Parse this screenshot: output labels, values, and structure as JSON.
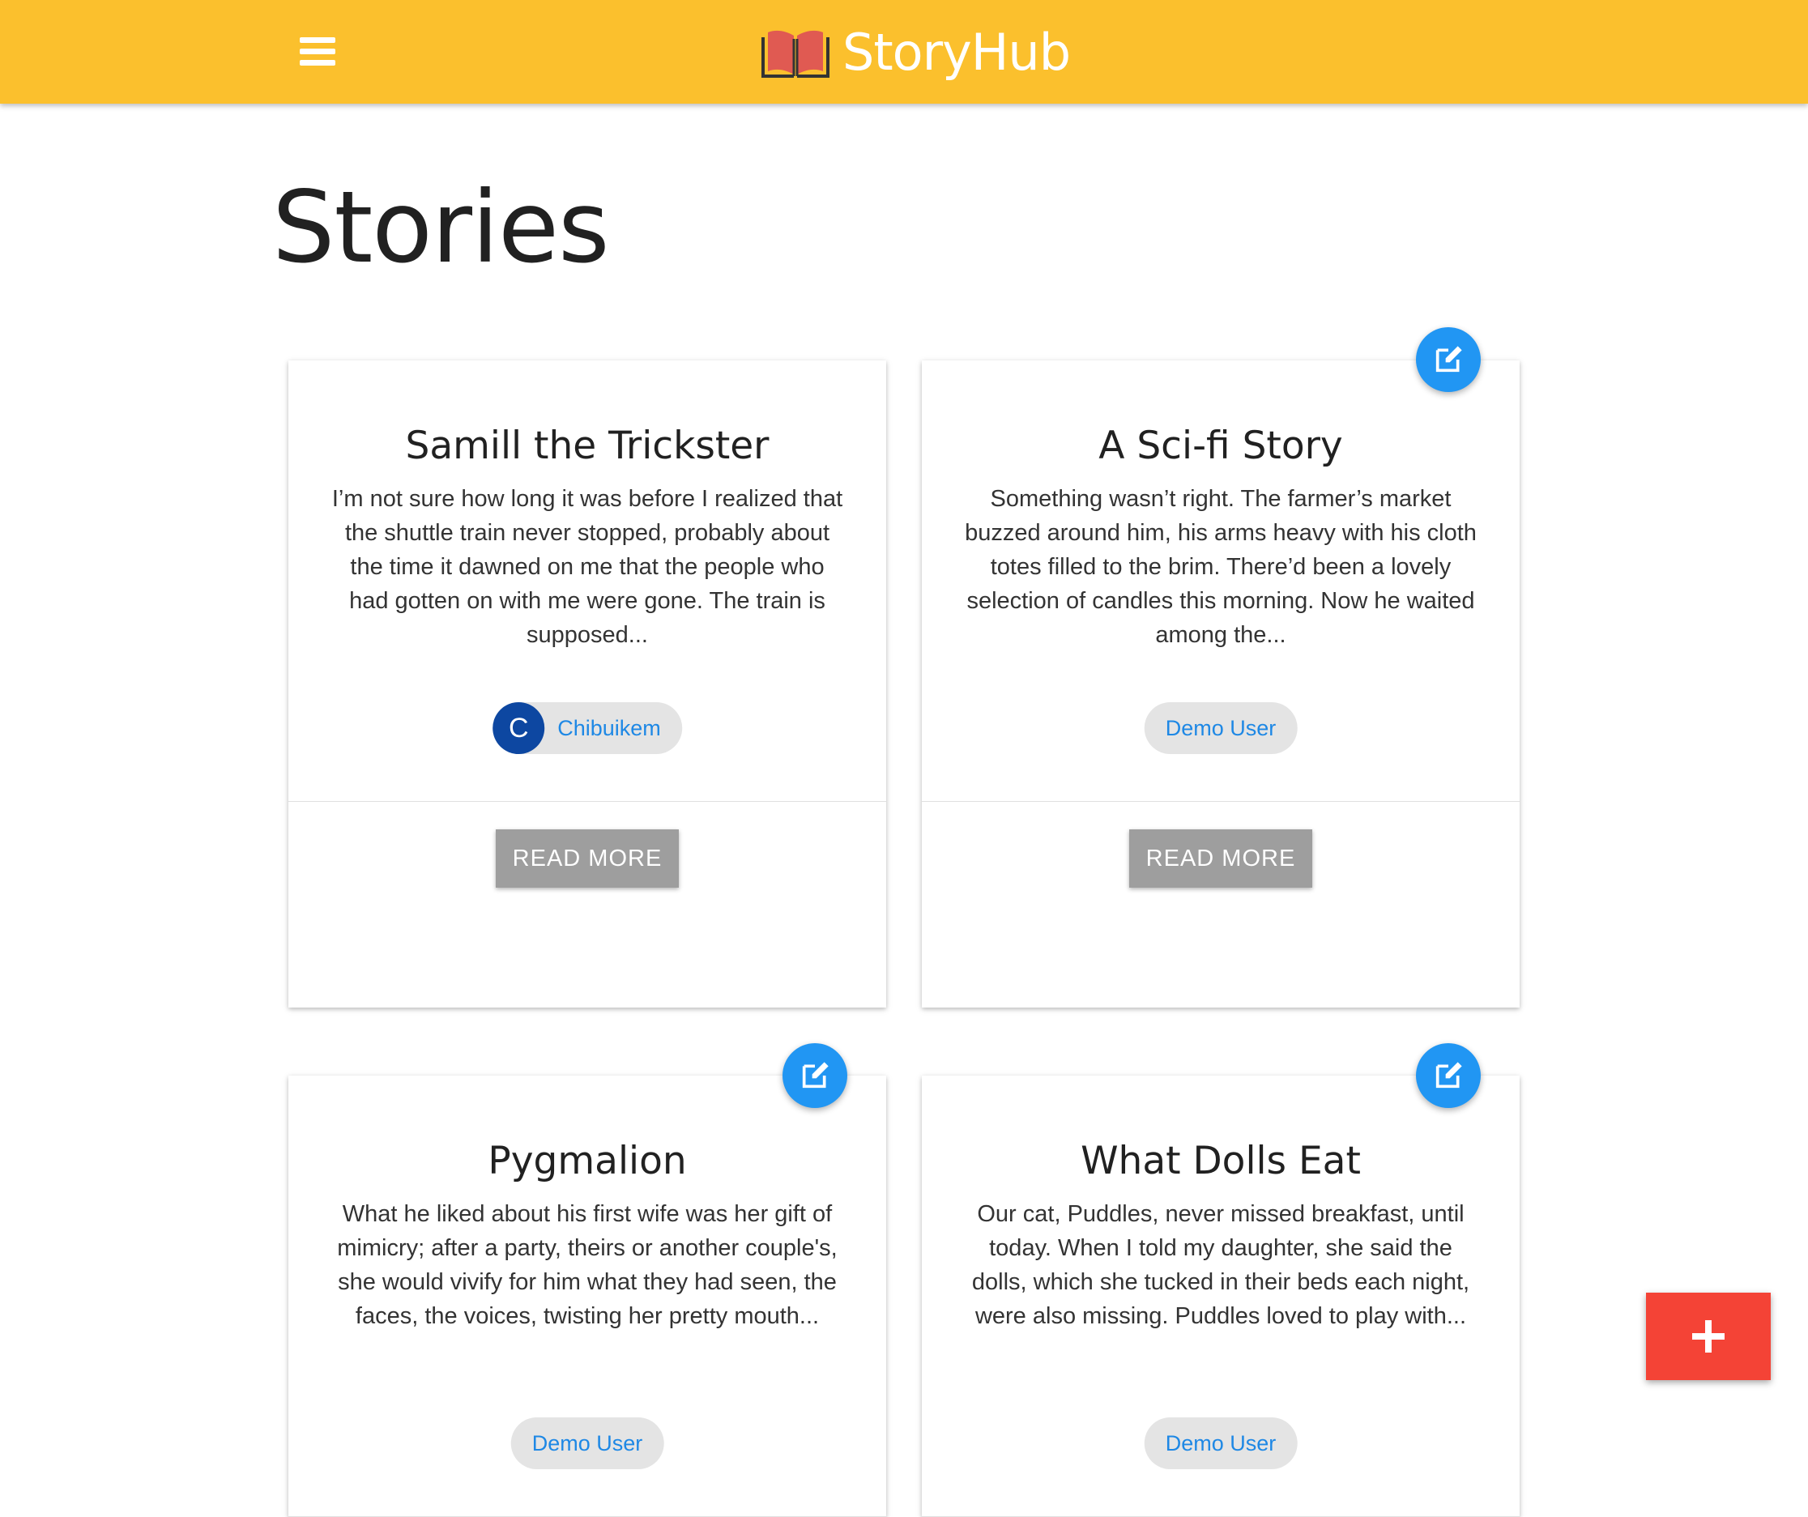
{
  "header": {
    "brand": "StoryHub",
    "menu_icon": "hamburger-menu-icon",
    "brand_icon": "open-book-icon",
    "background": "#fbc02d"
  },
  "page": {
    "title": "Stories"
  },
  "stories": [
    {
      "title": "Samill the Trickster",
      "excerpt": "I’m not sure how long it was before I realized that the shuttle train never stopped, probably about the time it dawned on me that the people who had gotten on with me were gone. The train is supposed...",
      "author": "Chibuikem",
      "author_initial": "C",
      "action": "READ MORE",
      "editable": false
    },
    {
      "title": "A Sci-fi Story",
      "excerpt": "Something wasn’t right. The farmer’s market buzzed around him, his arms heavy with his cloth totes filled to the brim. There’d been a lovely selection of candles this morning. Now he waited among the...",
      "author": "Demo User",
      "action": "READ MORE",
      "editable": true
    },
    {
      "title": "Pygmalion",
      "excerpt": "What he liked about his first wife was her gift of mimicry; after a party, theirs or another couple's, she would vivify for him what they had seen, the faces, the voices, twisting her pretty mouth...",
      "author": "Demo User",
      "editable": true
    },
    {
      "title": "What Dolls Eat",
      "excerpt": "Our cat, Puddles, never missed breakfast, until today. When I told my daughter, she said the dolls, which she tucked in their beds each night, were also missing. Puddles loved to play with...",
      "author": "Demo User",
      "editable": true
    }
  ],
  "fab": {
    "icon": "plus-icon",
    "color": "#f44336"
  },
  "colors": {
    "accent": "#2196f3",
    "avatar": "#0d47a1",
    "link": "#1e88e5",
    "button": "#9e9e9e"
  }
}
